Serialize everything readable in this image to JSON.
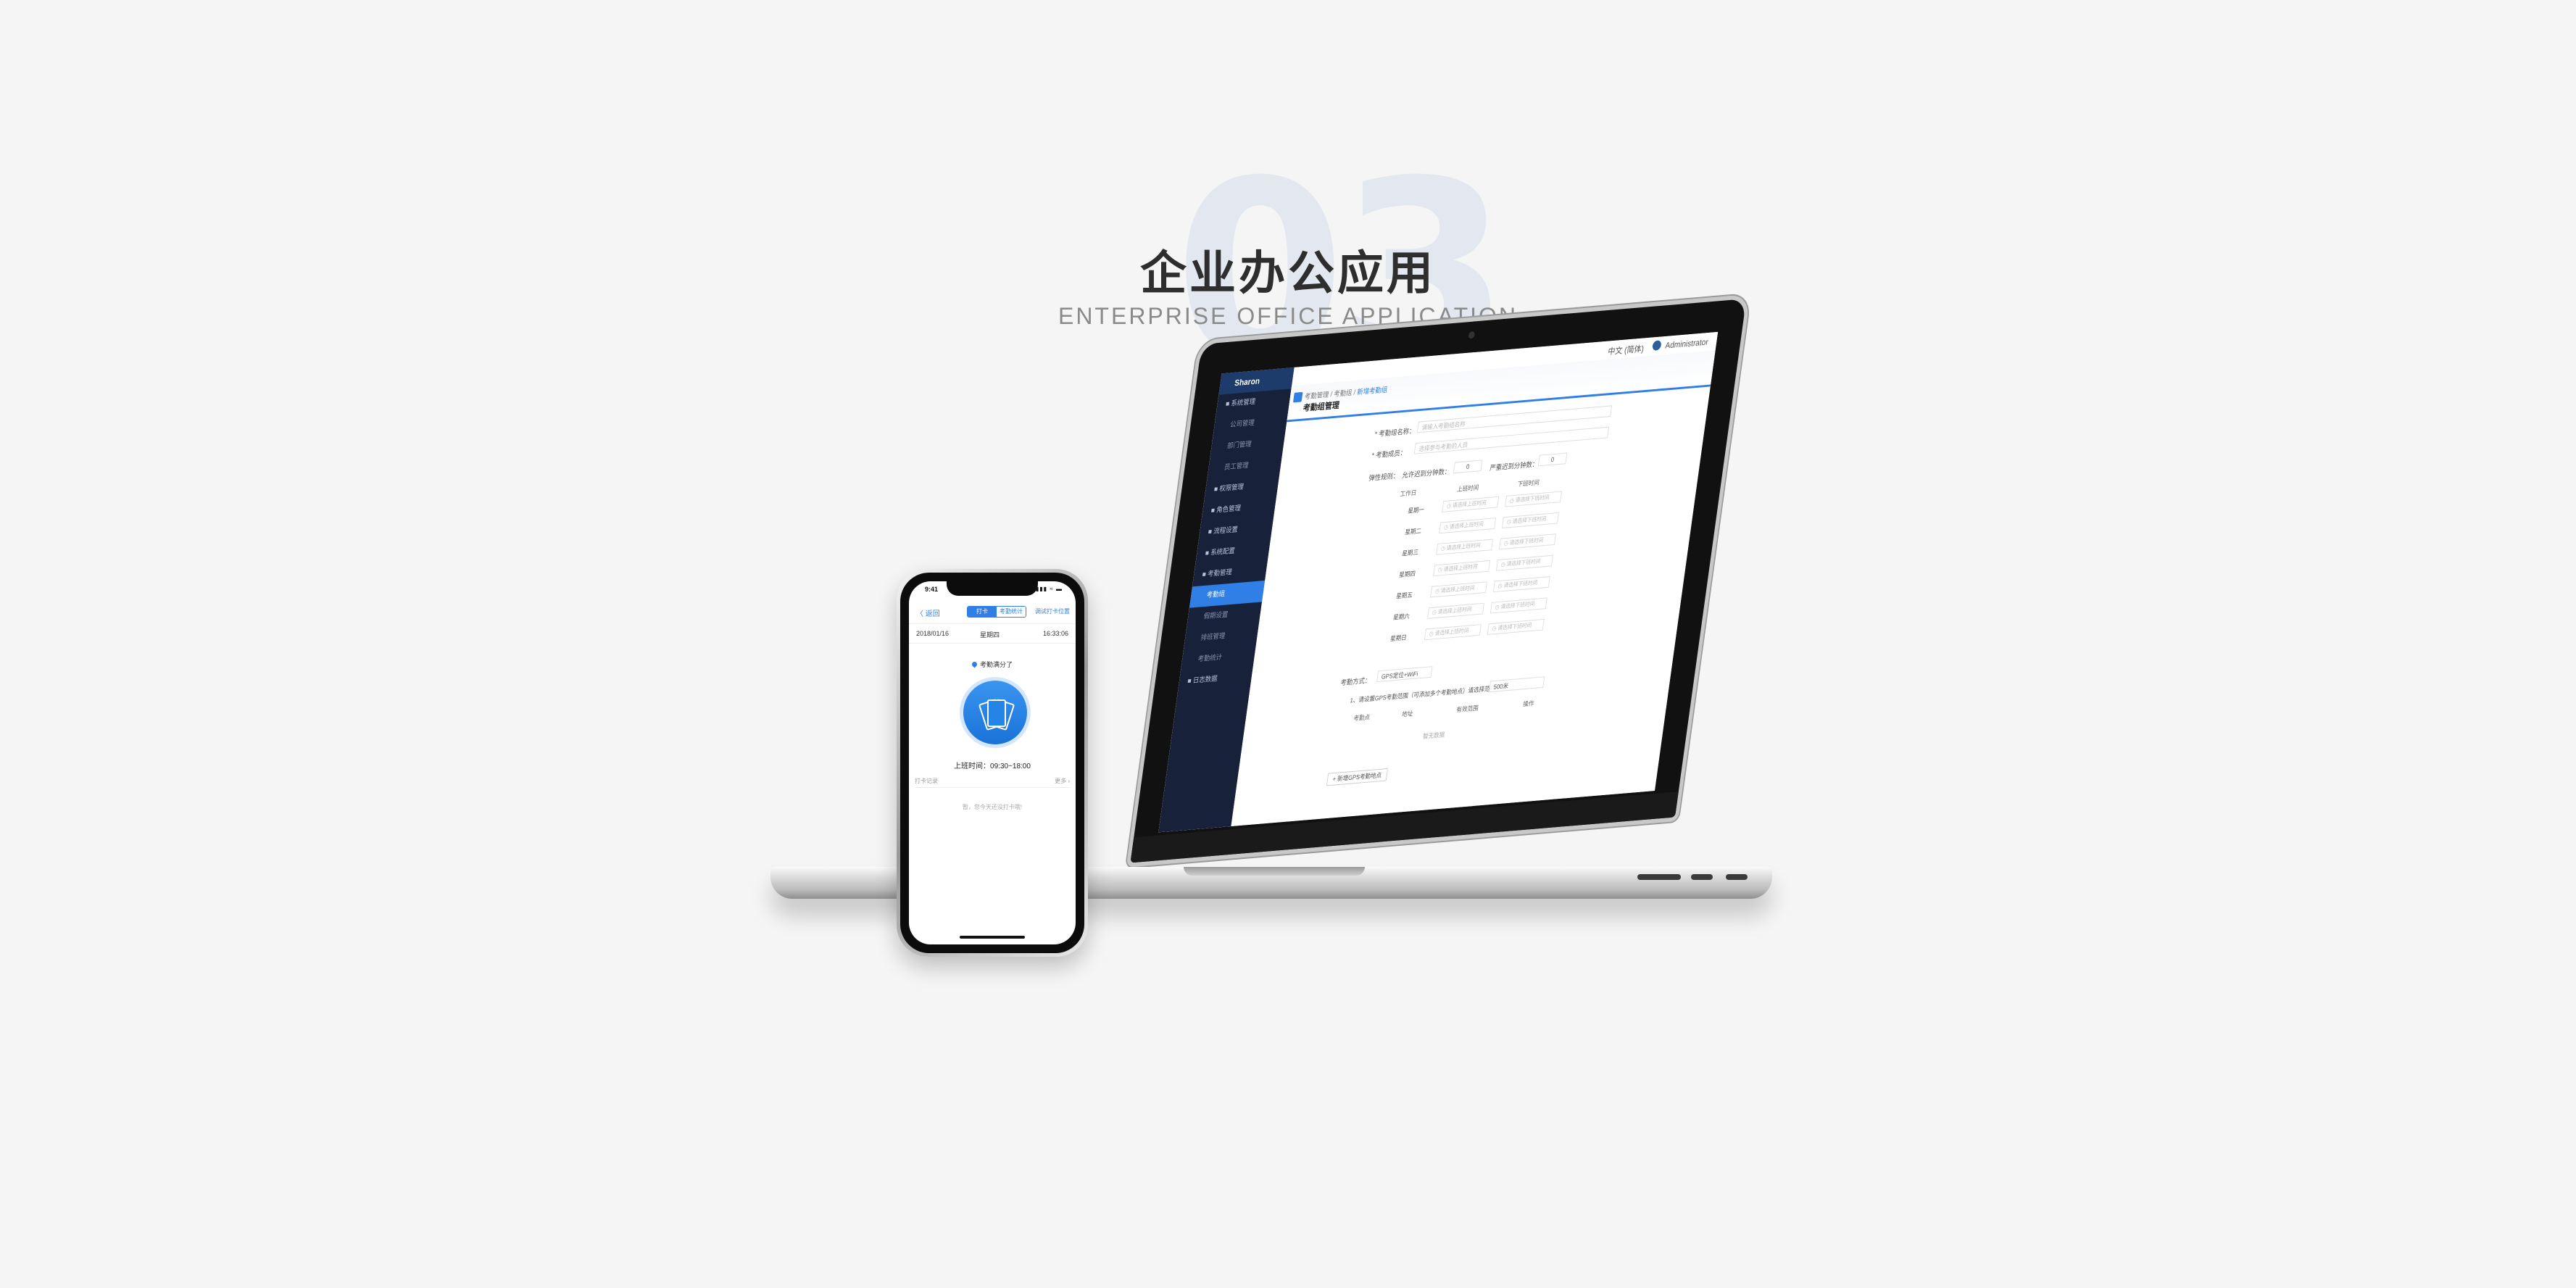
{
  "hero": {
    "bg_number": "03",
    "title": "企业办公应用",
    "subtitle": "ENTERPRISE OFFICE APPLICATION"
  },
  "laptop_app": {
    "logo": "Sharon",
    "topbar": {
      "language": "中文 (简体)",
      "user": "Administrator"
    },
    "sidebar": [
      {
        "label": "■ 系统管理",
        "sub": false
      },
      {
        "label": "公司管理",
        "sub": true
      },
      {
        "label": "部门管理",
        "sub": true
      },
      {
        "label": "员工管理",
        "sub": true
      },
      {
        "label": "■ 权限管理",
        "sub": false
      },
      {
        "label": "■ 角色管理",
        "sub": false
      },
      {
        "label": "■ 流程设置",
        "sub": false
      },
      {
        "label": "■ 系统配置",
        "sub": false
      },
      {
        "label": "■ 考勤管理",
        "sub": false
      },
      {
        "label": "考勤组",
        "sub": true,
        "active": true
      },
      {
        "label": "假期设置",
        "sub": true
      },
      {
        "label": "排班管理",
        "sub": true
      },
      {
        "label": "考勤统计",
        "sub": true
      },
      {
        "label": "■ 日志数据",
        "sub": false
      }
    ],
    "breadcrumb": {
      "parent": "考勤管理 / 考勤组 /",
      "current": "新增考勤组"
    },
    "page_title": "考勤组管理",
    "form": {
      "name_label": "* 考勤组名称：",
      "name_placeholder": "请输入考勤组名称",
      "members_label": "* 考勤成员：",
      "members_placeholder": "选择参与考勤的人员",
      "rule_label": "弹性规则：",
      "late_label": "允许迟到分钟数：",
      "late_value": "0",
      "severe_label": "严重迟到分钟数：",
      "severe_value": "0",
      "col_day": "工作日",
      "col_start": "上班时间",
      "col_end": "下班时间",
      "days": [
        "星期一",
        "星期二",
        "星期三",
        "星期四",
        "星期五",
        "星期六",
        "星期日"
      ],
      "start_placeholder": "◷ 请选择上班时间",
      "end_placeholder": "◷ 请选择下班时间",
      "method_label": "考勤方式：",
      "method_value": "GPS定位+WiFi",
      "range_label": "1、请设置GPS考勤范围（可添加多个考勤地点）请选择范围：",
      "range_value": "500米",
      "table_cols": [
        "考勤点",
        "地址",
        "有效范围",
        "操作"
      ],
      "empty_text": "暂无数据",
      "add_button": "+ 新增GPS考勤地点"
    }
  },
  "phone_app": {
    "status_time": "9:41",
    "status_icons": "▮▮▮ ≈ ▬",
    "back": "〈 返回",
    "segment_on": "打卡",
    "segment_off": "考勤统计",
    "nav_right": "调试打卡位置",
    "date": "2018/01/16",
    "weekday": "星期四",
    "clock": "16:33:06",
    "location": "考勤满分了",
    "worktime": "上班时间：09:30~18:00",
    "record_left": "打卡记录",
    "record_right": "更多 ›",
    "empty": "暂，您今天还没打卡哦!"
  }
}
